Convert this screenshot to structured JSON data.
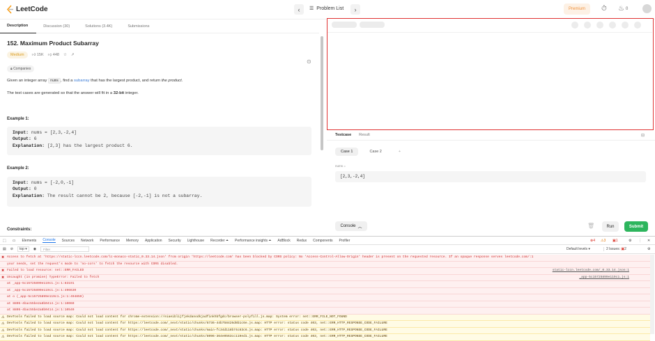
{
  "topbar": {
    "logo_text": "LeetCode",
    "problem_list": "Problem List",
    "premium": "Premium",
    "streak_count": "0",
    "icons": [
      "prev-icon",
      "list-icon",
      "next-icon",
      "timer-icon",
      "fire-icon"
    ]
  },
  "tabs": [
    "Description",
    "Discussion (30)",
    "Solutions (3.4K)",
    "Submissions"
  ],
  "problem": {
    "title": "152. Maximum Product Subarray",
    "difficulty": "Medium",
    "likes": "15K",
    "dislikes": "448",
    "companies": "Companies",
    "desc_1": "Given an integer array ",
    "desc_code": "nums",
    "desc_2": ", find a ",
    "desc_link": "subarray",
    "desc_3": " that has the largest product, and return ",
    "desc_4": "the product",
    "desc_5": ".",
    "fits_1": "The test cases are generated so that the answer will fit in a ",
    "fits_bold": "32-bit",
    "fits_2": " integer.",
    "example1_title": "Example 1:",
    "example1": {
      "input_label": "Input:",
      "input": " nums = [2,3,-2,4]",
      "output_label": "Output:",
      "output": " 6",
      "expl_label": "Explanation:",
      "expl": " [2,3] has the largest product 6."
    },
    "example2_title": "Example 2:",
    "example2": {
      "input_label": "Input:",
      "input": " nums = [-2,0,-1]",
      "output_label": "Output:",
      "output": " 0",
      "expl_label": "Explanation:",
      "expl": " The result cannot be 2, because [-2,-1] is not a subarray."
    },
    "constraints": "Constraints:"
  },
  "testpanel": {
    "tab_testcase": "Testcase",
    "tab_result": "Result",
    "case1": "Case 1",
    "case2": "Case 2",
    "add": "+",
    "nums_label": "nums =",
    "nums_value": "[2,3,-2,4]",
    "console": "Console",
    "run": "Run",
    "submit": "Submit"
  },
  "devtools": {
    "tabs": [
      "Elements",
      "Console",
      "Sources",
      "Network",
      "Performance",
      "Memory",
      "Application",
      "Security",
      "Lighthouse",
      "Recorder ⏶",
      "Performance insights ⏶",
      "AdBlock",
      "Redux",
      "Components",
      "Profiler"
    ],
    "active_tab": "Console",
    "context": "top ▾",
    "filter_placeholder": "Filter",
    "levels": "Default levels ▾",
    "issues": "2 Issues: ",
    "issue_count": "2",
    "err_count": "4",
    "warn_count": "3",
    "info_count": "1",
    "rows": [
      {
        "type": "err",
        "icon": "✖",
        "text": "Access to fetch at 'https://static-lccn.leetcode.com/lc-monaco-static_0.33.14.json' from origin 'https://leetcode.com' has been blocked by CORS policy: No 'Access-Control-Allow-Origin' header is present on the requested resource. If an opaque response serves leetcode.com/:1",
        "src": ""
      },
      {
        "type": "err",
        "icon": "",
        "text": "your needs, set the request's mode to 'no-cors' to fetch the resource with CORS disabled.",
        "src": ""
      },
      {
        "type": "err",
        "icon": "✖",
        "text": "Failed to load resource: net::ERR_FAILED",
        "src": "static-lccn.leetcode.com/_0.33.14.json:1"
      },
      {
        "type": "err",
        "icon": "✖",
        "text": "Uncaught (in promise) TypeError: Failed to fetch",
        "src": "_app-5c15725899e119c1.js:1"
      },
      {
        "type": "err",
        "icon": "",
        "text": "    at _app-5c15725899e119c1.js:1:83191",
        "src": ""
      },
      {
        "type": "err",
        "icon": "",
        "text": "    at _app-5c15725899e119c1.js:1:496630",
        "src": ""
      },
      {
        "type": "err",
        "icon": "",
        "text": "    at o (_app-5c15725899e119c1.js:1:494859)",
        "src": ""
      },
      {
        "type": "err",
        "icon": "",
        "text": "    at 8805-4bac55be2a8b0414.js:1:10060",
        "src": ""
      },
      {
        "type": "err",
        "icon": "",
        "text": "    at 8805-4bac55be2a8b0414.js:1:10540",
        "src": ""
      },
      {
        "type": "warn",
        "icon": "⚠",
        "text": "DevTools failed to load source map: Could not load content for chrome-extension://eiaeiblijfjekdanodkjadfinkhbfgdc/browser-polyfill.js.map: System error: net::ERR_FILE_NOT_FOUND",
        "src": ""
      },
      {
        "type": "warn",
        "icon": "⚠",
        "text": "DevTools failed to load source map: Could not load content for https://leetcode.com/_next/static/chunks/8736-44b758426d8b1c6e.js.map: HTTP error: status code 403, net::ERR_HTTP_RESPONSE_CODE_FAILURE",
        "src": ""
      },
      {
        "type": "warn",
        "icon": "⚠",
        "text": "DevTools failed to load source map: Could not load content for https://leetcode.com/_next/static/chunks/main-fc34d118b74c83c6.js.map: HTTP error: status code 403, net::ERR_HTTP_RESPONSE_CODE_FAILURE",
        "src": ""
      },
      {
        "type": "warn",
        "icon": "⚠",
        "text": "DevTools failed to load source map: Could not load content for https://leetcode.com/_next/static/chunks/8096-364e0563cc119ed1.js.map: HTTP error: status code 403, net::ERR_HTTP_RESPONSE_CODE_FAILURE",
        "src": ""
      }
    ]
  }
}
